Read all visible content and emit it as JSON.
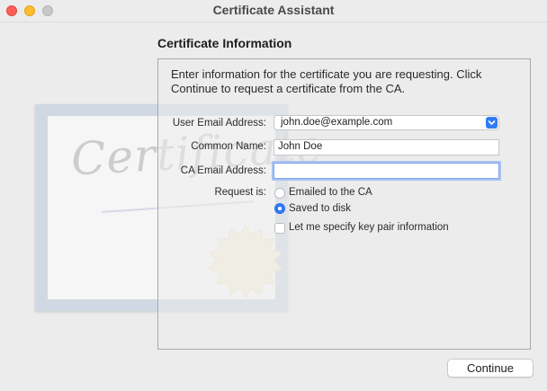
{
  "window": {
    "title": "Certificate Assistant"
  },
  "section": {
    "title": "Certificate Information"
  },
  "intro": "Enter information for the certificate you are requesting. Click Continue to request a certificate from the CA.",
  "illustration": {
    "word": "Certificate"
  },
  "form": {
    "user_email_label": "User Email Address:",
    "user_email_value": "john.doe@example.com",
    "common_name_label": "Common Name:",
    "common_name_value": "John Doe",
    "ca_email_label": "CA Email Address:",
    "ca_email_value": "",
    "request_label": "Request is:",
    "request_options": [
      {
        "label": "Emailed to the CA",
        "selected": false
      },
      {
        "label": "Saved to disk",
        "selected": true
      }
    ],
    "keypair_label": "Let me specify key pair information",
    "keypair_checked": false
  },
  "buttons": {
    "continue": "Continue"
  },
  "colors": {
    "accent": "#2f7bf5",
    "close": "#ff5f57",
    "minimize": "#febc2e"
  }
}
